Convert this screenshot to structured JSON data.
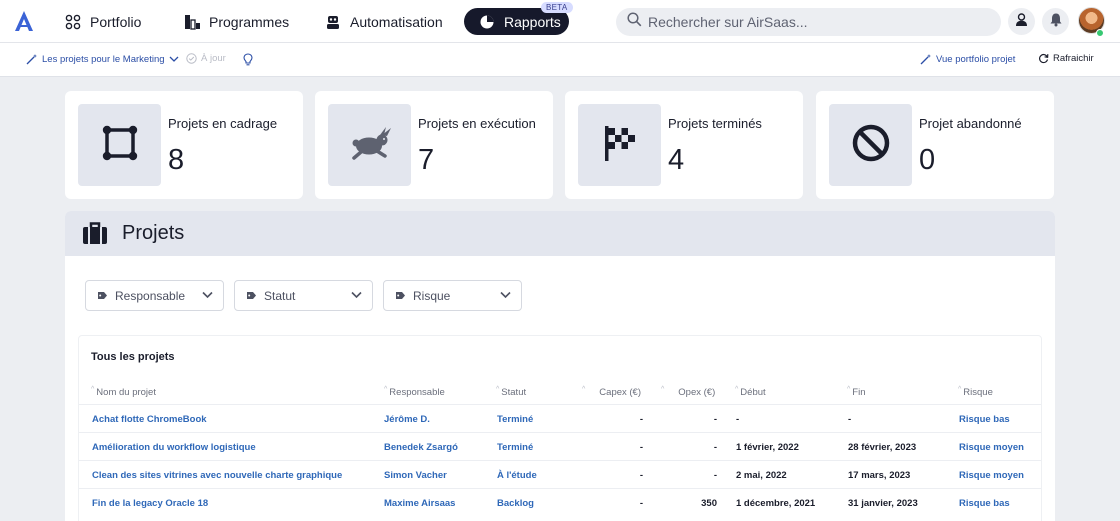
{
  "nav": {
    "items": [
      {
        "label": "Portfolio",
        "icon": "portfolio-icon"
      },
      {
        "label": "Programmes",
        "icon": "programmes-icon"
      },
      {
        "label": "Automatisation",
        "icon": "robot-icon"
      },
      {
        "label": "Rapports",
        "icon": "pie-chart-icon",
        "badge": "BETA",
        "active": true
      }
    ],
    "search_placeholder": "Rechercher sur AirSaas..."
  },
  "subbar": {
    "view_label": "Les projets pour le Marketing",
    "sync_label": "À jour",
    "portfolio_link": "Vue portfolio projet",
    "refresh_label": "Rafraichir"
  },
  "stats": [
    {
      "label": "Projets en cadrage",
      "value": "8",
      "icon": "frame-icon"
    },
    {
      "label": "Projets en exécution",
      "value": "7",
      "icon": "rabbit-icon"
    },
    {
      "label": "Projets terminés",
      "value": "4",
      "icon": "checkered-flag-icon"
    },
    {
      "label": "Projet abandonné",
      "value": "0",
      "icon": "prohibited-icon"
    }
  ],
  "projects": {
    "title": "Projets",
    "filters": [
      "Responsable",
      "Statut",
      "Risque"
    ],
    "table": {
      "title": "Tous les projets",
      "columns": [
        "Nom du projet",
        "Responsable",
        "Statut",
        "Capex (€)",
        "Opex (€)",
        "Début",
        "Fin",
        "Risque"
      ],
      "rows": [
        {
          "name": "Achat flotte ChromeBook",
          "owner": "Jérôme D.",
          "status": "Terminé",
          "capex": "-",
          "opex": "-",
          "start": "-",
          "end": "-",
          "risk": "Risque bas"
        },
        {
          "name": "Amélioration du workflow logistique",
          "owner": "Benedek Zsargó",
          "status": "Terminé",
          "capex": "-",
          "opex": "-",
          "start": "1 février, 2022",
          "end": "28 février, 2023",
          "risk": "Risque moyen"
        },
        {
          "name": "Clean des sites vitrines avec nouvelle charte graphique",
          "owner": "Simon Vacher",
          "status": "À l'étude",
          "capex": "-",
          "opex": "-",
          "start": "2 mai, 2022",
          "end": "17 mars, 2023",
          "risk": "Risque moyen"
        },
        {
          "name": "Fin de la legacy Oracle 18",
          "owner": "Maxime Airsaas",
          "status": "Backlog",
          "capex": "-",
          "opex": "350",
          "start": "1 décembre, 2021",
          "end": "31 janvier, 2023",
          "risk": "Risque bas"
        }
      ]
    }
  },
  "colors": {
    "accent": "#2f68b8",
    "nav_active_bg": "#16192b",
    "page_bg": "#eceef2",
    "tile_bg": "#e3e6ee"
  }
}
